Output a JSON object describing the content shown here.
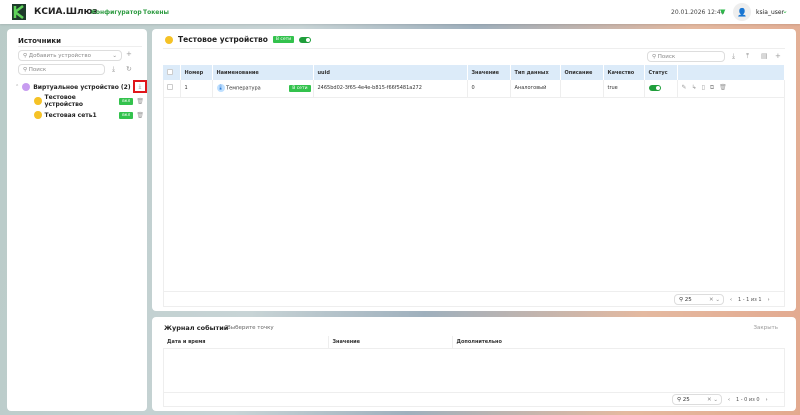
{
  "header": {
    "brand": "КСИА.Шлюз",
    "nav": [
      "Конфигуратор",
      "Токены"
    ],
    "datetime": "20.01.2026 12:40",
    "username": "ksia_user"
  },
  "sidebar": {
    "title": "Источники",
    "add_device_placeholder": "Добавить устройство",
    "search_placeholder": "Поиск",
    "tree": {
      "label": "Виртуальное устройство (2)",
      "children": [
        {
          "label": "Тестовое устройство",
          "badge": "вкл"
        },
        {
          "label": "Тестовая сеть1",
          "badge": "вкл"
        }
      ]
    }
  },
  "main": {
    "title": "Тестовое устройство",
    "status_badge": "В сети",
    "search_placeholder": "Поиск",
    "columns": [
      "Номер",
      "Наименование",
      "uuid",
      "Значение",
      "Тип данных",
      "Описание",
      "Качество",
      "Статус"
    ],
    "rows": [
      {
        "number": "1",
        "name": "Температура",
        "badge": "В сети",
        "uuid": "2465bd02-3f65-4e4e-b815-f66f5481a272",
        "value": "0",
        "type": "Аналоговый",
        "description": "",
        "quality": "true",
        "status": true
      }
    ],
    "page_size": "25",
    "pagination": "1 - 1 из 1"
  },
  "journal": {
    "title": "Журнал событий",
    "subtitle": "Выберите точку",
    "close": "Закрыть",
    "columns": [
      "Дата и время",
      "Значение",
      "Дополнительно"
    ],
    "page_size": "25",
    "pagination": "1 - 0 из 0"
  }
}
